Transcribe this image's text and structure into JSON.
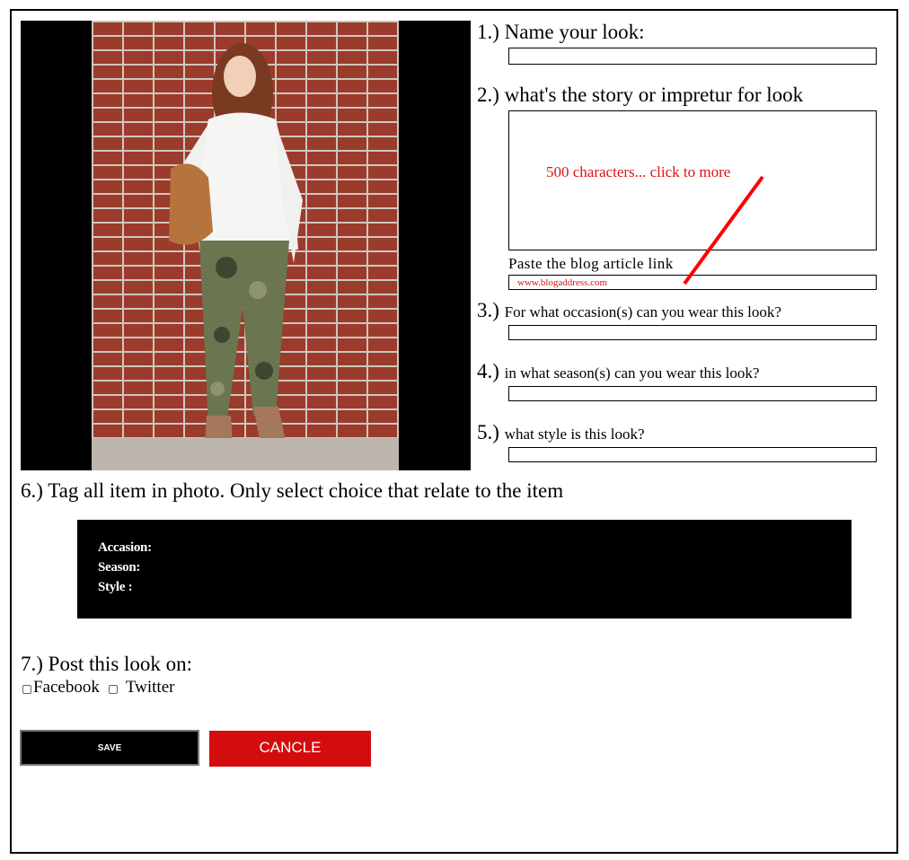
{
  "form": {
    "q1": "1.) Name your look:",
    "q2": "2.) what's the story or impretur for look",
    "story_hint": "500 characters... click to more",
    "link_label": "Paste the blog article link",
    "link_placeholder": "www.blogaddress.com",
    "q3_num": "3.)",
    "q3_text": "For what occasion(s) can you wear this look?",
    "q4_num": "4.)",
    "q4_text": "in what season(s) can you wear this look?",
    "q5_num": "5.)",
    "q5_text": "what style is this look?",
    "q6": "6.) Tag all item in photo. Only select choice that relate to the item",
    "tags": {
      "accasion": "Accasion:",
      "season": "Season:",
      "style": "Style :"
    },
    "q7": "7.) Post this look on:",
    "facebook": "Facebook",
    "twitter": "Twitter",
    "save": "SAVE",
    "cancle": "CANCLE"
  },
  "colors": {
    "accent_red": "#d30d0d",
    "hint_red": "#dd1111",
    "tag_bg": "#000000"
  }
}
